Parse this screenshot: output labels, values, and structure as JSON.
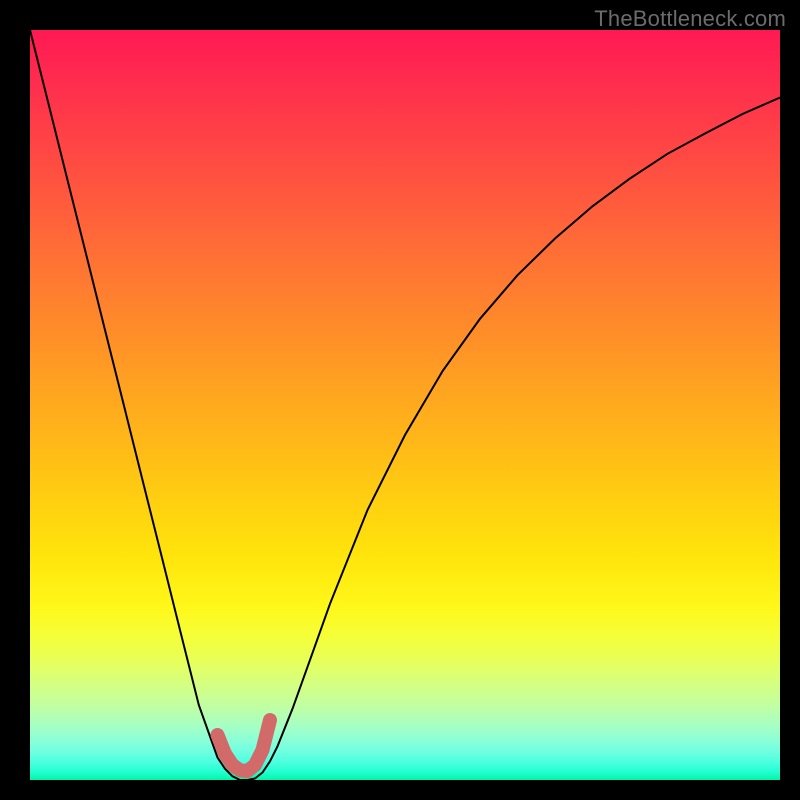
{
  "watermark": "TheBottleneck.com",
  "domain": "Chart",
  "chart_data": {
    "type": "line",
    "title": "",
    "xlabel": "",
    "ylabel": "",
    "xlim": [
      0,
      1
    ],
    "ylim": [
      0,
      1
    ],
    "grid": false,
    "background_gradient": {
      "orientation": "vertical",
      "top_color": "#ff1954",
      "mid_color": "#ffe40b",
      "bottom_color": "#00f5a8"
    },
    "series": [
      {
        "name": "bottleneck-curve",
        "color": "#000000",
        "x": [
          0.0,
          0.025,
          0.05,
          0.075,
          0.1,
          0.125,
          0.15,
          0.175,
          0.2,
          0.225,
          0.25,
          0.26,
          0.27,
          0.28,
          0.29,
          0.3,
          0.31,
          0.32,
          0.33,
          0.35,
          0.375,
          0.4,
          0.45,
          0.5,
          0.55,
          0.6,
          0.65,
          0.7,
          0.75,
          0.8,
          0.85,
          0.9,
          0.95,
          1.0
        ],
        "y": [
          1.0,
          0.9,
          0.8,
          0.7,
          0.6,
          0.5,
          0.4,
          0.3,
          0.2,
          0.1,
          0.03,
          0.015,
          0.005,
          0.0,
          0.0,
          0.002,
          0.01,
          0.025,
          0.045,
          0.095,
          0.165,
          0.235,
          0.36,
          0.46,
          0.545,
          0.615,
          0.673,
          0.722,
          0.765,
          0.802,
          0.835,
          0.862,
          0.888,
          0.91
        ]
      }
    ],
    "curve_minimum": {
      "x": 0.285,
      "y": 0.0
    },
    "marker": {
      "name": "highlight-segment",
      "color": "#d26a6a",
      "points_x": [
        0.25,
        0.26,
        0.27,
        0.28,
        0.29,
        0.3,
        0.31,
        0.32
      ],
      "points_y": [
        0.05,
        0.025,
        0.01,
        0.003,
        0.002,
        0.01,
        0.03,
        0.07
      ]
    }
  }
}
